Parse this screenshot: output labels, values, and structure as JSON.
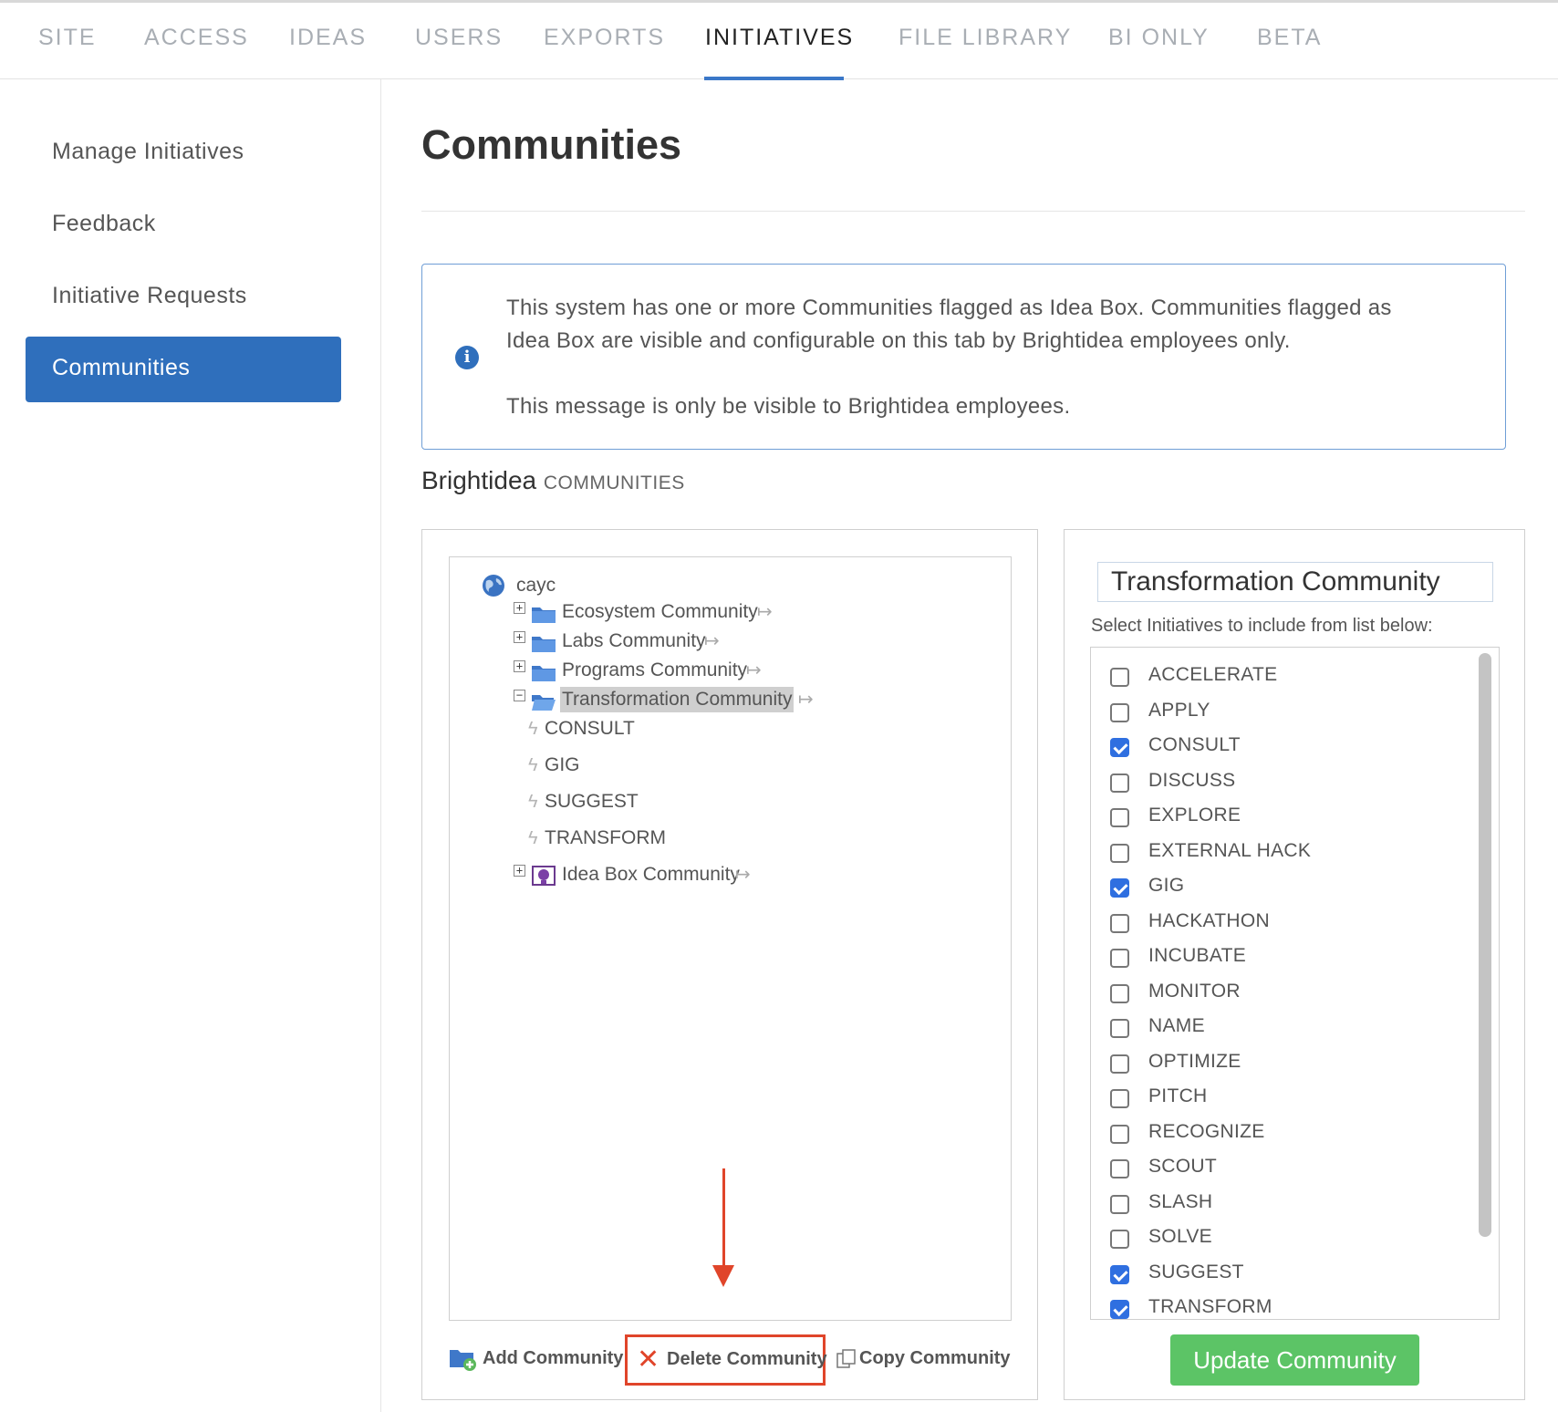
{
  "top_tabs": [
    {
      "label": "SITE"
    },
    {
      "label": "ACCESS"
    },
    {
      "label": "IDEAS"
    },
    {
      "label": "USERS"
    },
    {
      "label": "EXPORTS"
    },
    {
      "label": "INITIATIVES",
      "active": true
    },
    {
      "label": "FILE LIBRARY"
    },
    {
      "label": "BI ONLY"
    },
    {
      "label": "BETA"
    }
  ],
  "sidebar": {
    "items": [
      {
        "label": "Manage Initiatives"
      },
      {
        "label": "Feedback"
      },
      {
        "label": "Initiative Requests"
      },
      {
        "label": "Communities",
        "active": true
      }
    ]
  },
  "page": {
    "title": "Communities"
  },
  "info": {
    "line1": "This system has one or more Communities flagged as Idea Box. Communities flagged as",
    "line2": "Idea Box are visible and configurable on this tab by Brightidea employees only.",
    "line3": "This message is only be visible to Brightidea employees."
  },
  "section": {
    "brand": "Brightidea",
    "label": "COMMUNITIES"
  },
  "tree": {
    "root": "cayc",
    "communities": [
      {
        "label": "Ecosystem Community"
      },
      {
        "label": "Labs Community"
      },
      {
        "label": "Programs Community"
      },
      {
        "label": "Transformation Community",
        "expanded": true,
        "selected": true
      }
    ],
    "initiatives": [
      "CONSULT",
      "GIG",
      "SUGGEST",
      "TRANSFORM"
    ],
    "idea_box": "Idea Box Community"
  },
  "actions": {
    "add": "Add Community",
    "delete": "Delete Community",
    "copy": "Copy Community"
  },
  "detail": {
    "community_name": "Transformation Community",
    "hint": "Select Initiatives to include from list below:",
    "initiatives": [
      {
        "label": "ACCELERATE",
        "checked": false
      },
      {
        "label": "APPLY",
        "checked": false
      },
      {
        "label": "CONSULT",
        "checked": true
      },
      {
        "label": "DISCUSS",
        "checked": false
      },
      {
        "label": "EXPLORE",
        "checked": false
      },
      {
        "label": "EXTERNAL HACK",
        "checked": false
      },
      {
        "label": "GIG",
        "checked": true
      },
      {
        "label": "HACKATHON",
        "checked": false
      },
      {
        "label": "INCUBATE",
        "checked": false
      },
      {
        "label": "MONITOR",
        "checked": false
      },
      {
        "label": "NAME",
        "checked": false
      },
      {
        "label": "OPTIMIZE",
        "checked": false
      },
      {
        "label": "PITCH",
        "checked": false
      },
      {
        "label": "RECOGNIZE",
        "checked": false
      },
      {
        "label": "SCOUT",
        "checked": false
      },
      {
        "label": "SLASH",
        "checked": false
      },
      {
        "label": "SOLVE",
        "checked": false
      },
      {
        "label": "SUGGEST",
        "checked": true
      },
      {
        "label": "TRANSFORM",
        "checked": true
      }
    ],
    "update_label": "Update Community"
  },
  "colors": {
    "accent": "#2f6fbc",
    "update_button": "#5cc466",
    "annotation": "#e0452a"
  }
}
